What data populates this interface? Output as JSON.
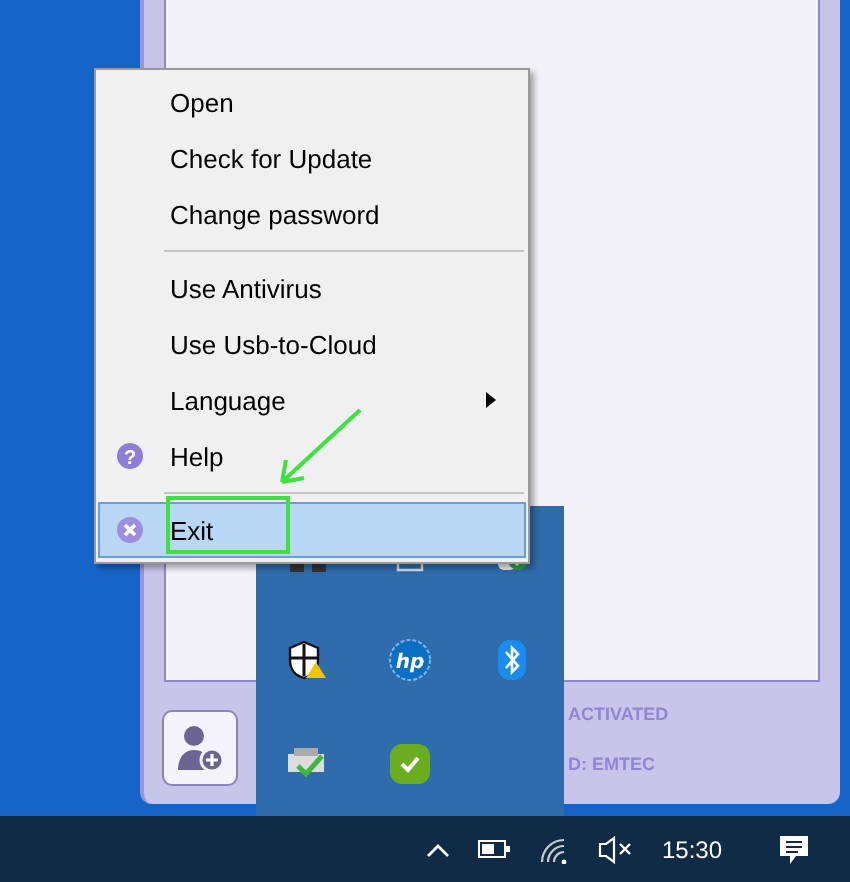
{
  "menu": {
    "items": [
      {
        "kind": "plain",
        "label": "Open",
        "selected": false
      },
      {
        "kind": "plain",
        "label": "Check for Update",
        "selected": false
      },
      {
        "kind": "plain",
        "label": "Change password",
        "selected": false
      },
      {
        "kind": "separator"
      },
      {
        "kind": "plain",
        "label": "Use Antivirus",
        "selected": false
      },
      {
        "kind": "plain",
        "label": "Use Usb-to-Cloud",
        "selected": false
      },
      {
        "kind": "submenu",
        "label": "Language",
        "selected": false
      },
      {
        "kind": "help",
        "label": "Help",
        "icon_text": "?",
        "selected": false
      },
      {
        "kind": "separator"
      },
      {
        "kind": "exit",
        "label": "Exit",
        "selected": true
      }
    ]
  },
  "app_window": {
    "status_lines": [
      "ACTIVATED",
      "D: EMTEC"
    ]
  },
  "tray": {
    "logo_text": "hp"
  },
  "taskbar": {
    "clock": "15:30"
  }
}
